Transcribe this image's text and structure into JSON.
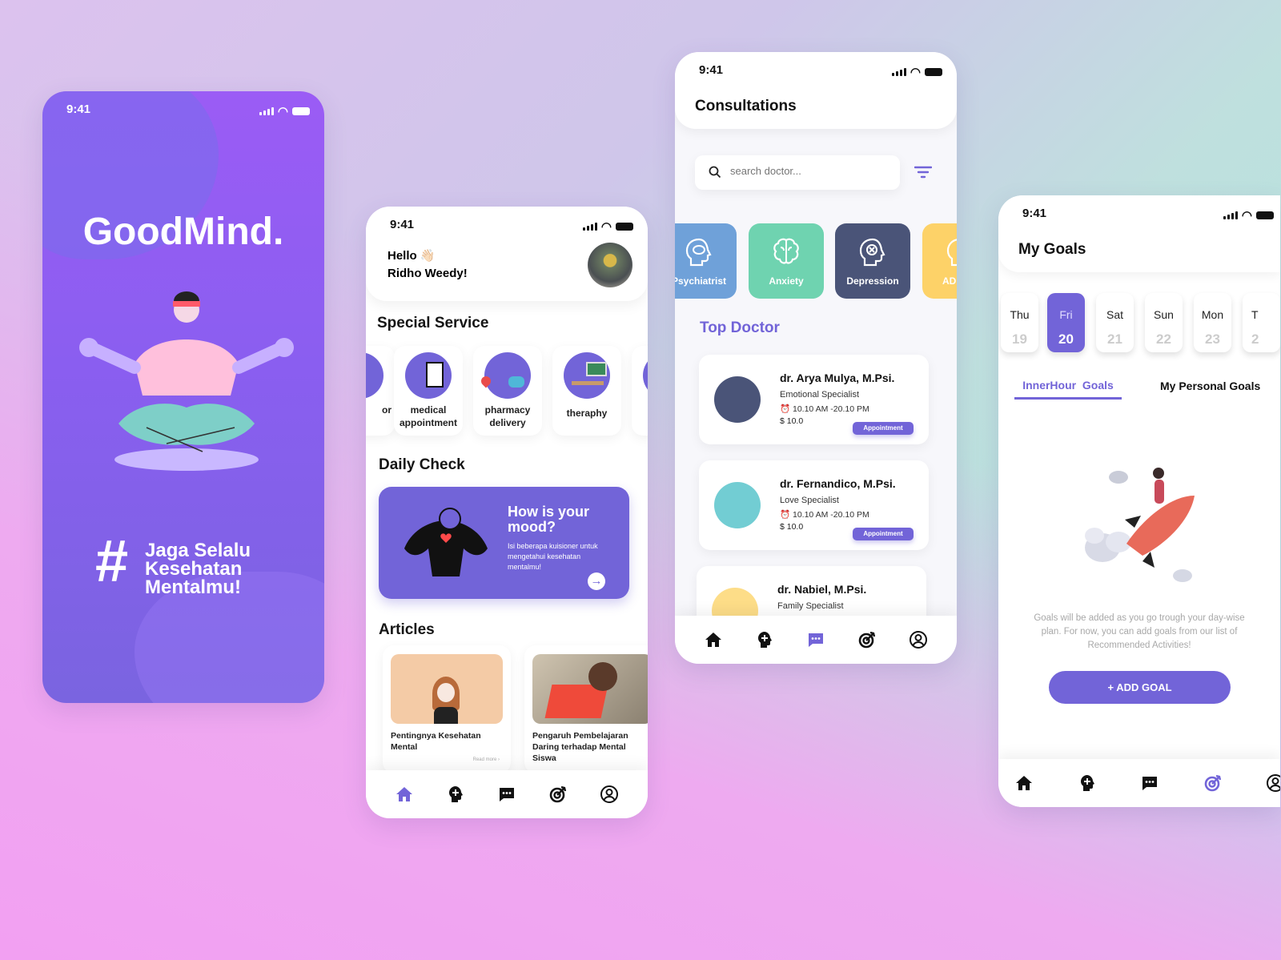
{
  "status_time": "9:41",
  "colors": {
    "accent": "#7264d8",
    "splash_top": "#9b5cf5",
    "splash_bottom": "#7a64e0",
    "psychiatrist": "#6fa1d9",
    "anxiety": "#6fd3b0",
    "depression": "#4a5478",
    "adhd": "#fdd268"
  },
  "splash": {
    "logo": "GoodMind.",
    "hashtag": "#",
    "slogan_lines": [
      "Jaga Selalu",
      "Kesehatan",
      "Mentalmu!"
    ]
  },
  "home": {
    "greeting": "Hello 👋🏻",
    "user_name": "Ridho Weedy!",
    "special_service_title": "Special Service",
    "services": [
      {
        "label": "or"
      },
      {
        "label": "medical appointment"
      },
      {
        "label": "pharmacy delivery"
      },
      {
        "label": "theraphy"
      }
    ],
    "daily_check_title": "Daily Check",
    "mood_card": {
      "title": "How is your mood?",
      "description": "Isi beberapa kuisioner untuk mengetahui kesehatan mentalmu!"
    },
    "articles_title": "Articles",
    "articles": [
      {
        "title": "Pentingnya Kesehatan Mental",
        "read_more": "Read more"
      },
      {
        "title": "Pengaruh Pembelajaran Daring terhadap Mental Siswa"
      }
    ]
  },
  "consultations": {
    "title": "Consultations",
    "search_placeholder": "search doctor...",
    "categories": [
      {
        "label": "Psychiatrist",
        "icon": "head-chat-icon"
      },
      {
        "label": "Anxiety",
        "icon": "brain-icon"
      },
      {
        "label": "Depression",
        "icon": "head-x-icon"
      },
      {
        "label": "AD",
        "icon": "head-icon"
      }
    ],
    "top_doctor_title": "Top Doctor",
    "doctors": [
      {
        "name": "dr. Arya Mulya, M.Psi.",
        "specialty": "Emotional Specialist",
        "hours": "10.10 AM -20.10 PM",
        "price": "$ 10.0",
        "button": "Appointment",
        "avatar_color": "#4a5478"
      },
      {
        "name": "dr. Fernandico, M.Psi.",
        "specialty": "Love Specialist",
        "hours": "10.10 AM -20.10 PM",
        "price": "$ 10.0",
        "button": "Appointment",
        "avatar_color": "#72cdd3"
      },
      {
        "name": "dr. Nabiel, M.Psi.",
        "specialty": "Family Specialist",
        "avatar_color": "#fddd88"
      }
    ]
  },
  "goals": {
    "title": "My Goals",
    "days": [
      {
        "name": "Thu",
        "date": "19"
      },
      {
        "name": "Fri",
        "date": "20",
        "selected": true
      },
      {
        "name": "Sat",
        "date": "21"
      },
      {
        "name": "Sun",
        "date": "22"
      },
      {
        "name": "Mon",
        "date": "23"
      },
      {
        "name": "T",
        "date": "2"
      }
    ],
    "tabs": [
      {
        "label": "InnerHour  Goals",
        "active": true
      },
      {
        "label": "My Personal Goals"
      }
    ],
    "empty_text": "Goals will be added as you go trough your day-wise plan. For now, you can add goals from our list of Recommended Activities!",
    "add_button": "+ ADD GOAL"
  },
  "nav": [
    "home",
    "mental-health",
    "chat",
    "goals",
    "profile"
  ]
}
